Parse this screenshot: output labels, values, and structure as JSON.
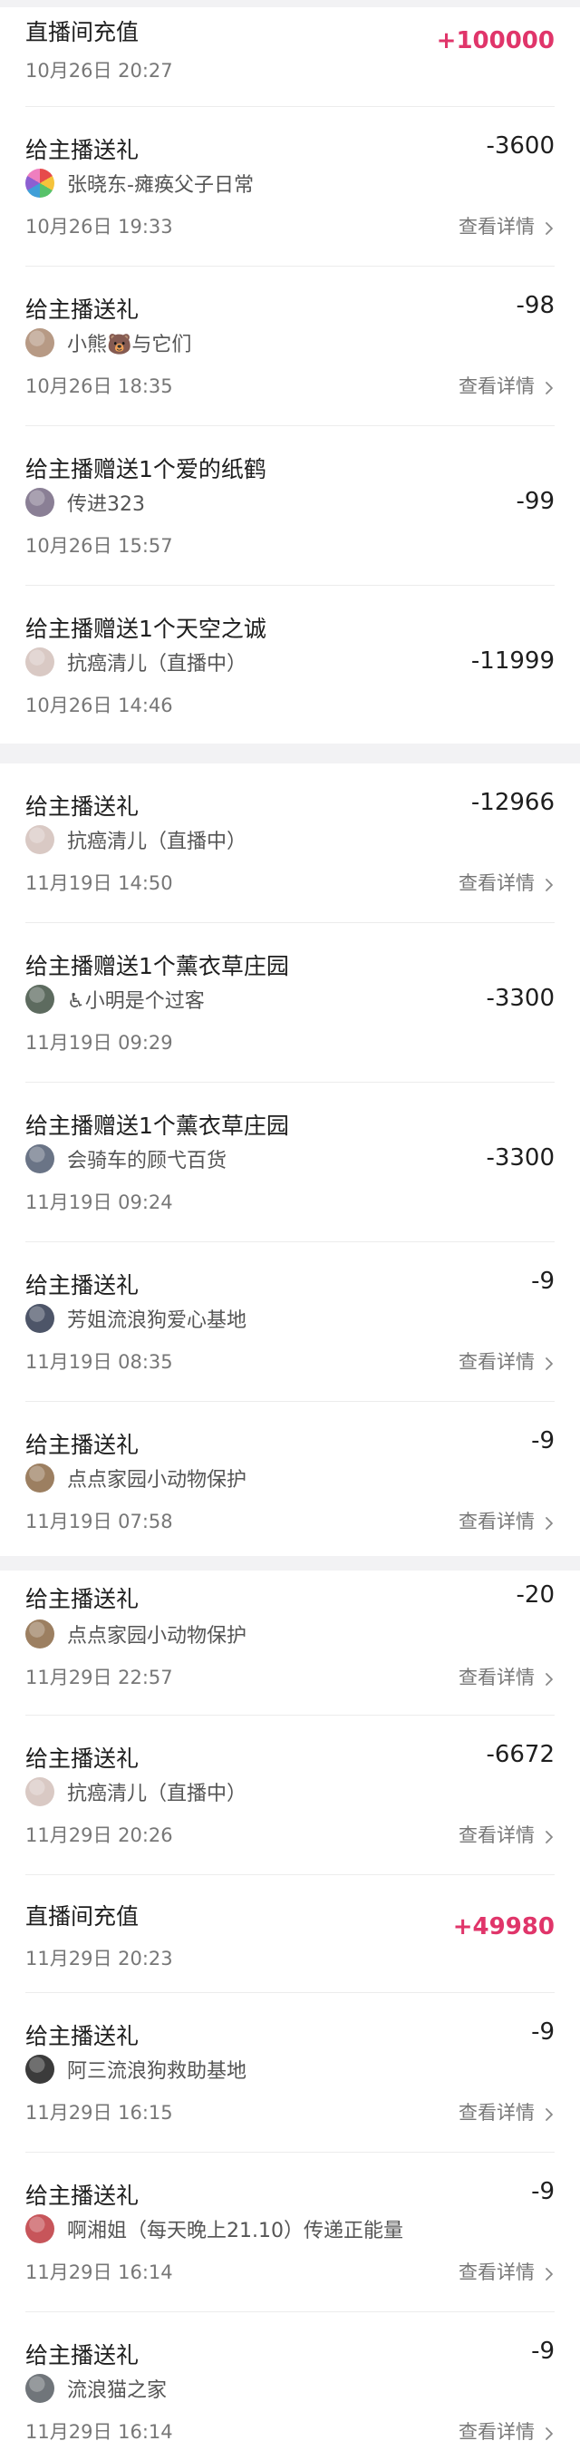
{
  "detail_label": "查看详情",
  "records": [
    {
      "title": "直播间充值",
      "amount": "+100000",
      "positive": true,
      "time": "10月26日 20:27"
    },
    {
      "title": "给主播送礼",
      "amount": "-3600",
      "user": "张晓东-瘫痪父子日常",
      "avatar_color": "#3f9fd8",
      "avatar_icon": "flower-avatar",
      "time": "10月26日 19:33",
      "has_detail": true
    },
    {
      "title": "给主播送礼",
      "amount": "-98",
      "user": "小熊🐻与它们",
      "avatar_color": "#b79a85",
      "time": "10月26日 18:35",
      "has_detail": true
    },
    {
      "title": "给主播赠送1个爱的纸鹤",
      "amount": "-99",
      "user": "传进323",
      "avatar_color": "#8a7f95",
      "time": "10月26日 15:57"
    },
    {
      "title": "给主播赠送1个天空之诚",
      "amount": "-11999",
      "user": "抗癌清儿（直播中）",
      "avatar_color": "#d9c9c4",
      "time": "10月26日 14:46"
    },
    {
      "title": "给主播送礼",
      "amount": "-12966",
      "user": "抗癌清儿（直播中）",
      "avatar_color": "#d9c9c4",
      "time": "11月19日 14:50",
      "has_detail": true
    },
    {
      "title": "给主播赠送1个薰衣草庄园",
      "amount": "-3300",
      "user": "♿小明是个过客",
      "avatar_color": "#5d6b5f",
      "time": "11月19日 09:29"
    },
    {
      "title": "给主播赠送1个薰衣草庄园",
      "amount": "-3300",
      "user": "会骑车的顾弋百货",
      "avatar_color": "#6a7486",
      "time": "11月19日 09:24"
    },
    {
      "title": "给主播送礼",
      "amount": "-9",
      "user": "芳姐流浪狗爱心基地",
      "avatar_color": "#4d5568",
      "time": "11月19日 08:35",
      "has_detail": true
    },
    {
      "title": "给主播送礼",
      "amount": "-9",
      "user": "点点家园小动物保护",
      "avatar_color": "#9c7f61",
      "time": "11月19日 07:58",
      "has_detail": true
    },
    {
      "title": "给主播送礼",
      "amount": "-20",
      "user": "点点家园小动物保护",
      "avatar_color": "#9c7f61",
      "time": "11月29日 22:57",
      "has_detail": true
    },
    {
      "title": "给主播送礼",
      "amount": "-6672",
      "user": "抗癌清儿（直播中）",
      "avatar_color": "#d9c9c4",
      "time": "11月29日 20:26",
      "has_detail": true
    },
    {
      "title": "直播间充值",
      "amount": "+49980",
      "positive": true,
      "time": "11月29日 20:23"
    },
    {
      "title": "给主播送礼",
      "amount": "-9",
      "user": "阿三流浪狗救助基地",
      "avatar_color": "#3b3b3b",
      "time": "11月29日 16:15",
      "has_detail": true
    },
    {
      "title": "给主播送礼",
      "amount": "-9",
      "user": "啊湘姐（每天晚上21.10）传递正能量",
      "avatar_color": "#c7555a",
      "time": "11月29日 16:14",
      "has_detail": true
    },
    {
      "title": "给主播送礼",
      "amount": "-9",
      "user": "流浪猫之家",
      "avatar_color": "#70757a",
      "time": "11月29日 16:14",
      "has_detail": true
    }
  ]
}
